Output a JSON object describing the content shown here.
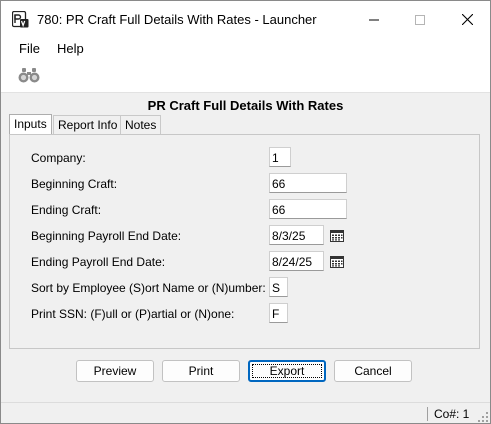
{
  "window": {
    "title": "780: PR Craft Full Details With Rates - Launcher",
    "app_icon": "report-launcher-icon"
  },
  "menu": {
    "file": "File",
    "help": "Help"
  },
  "toolbar": {
    "find_icon": "binoculars-icon"
  },
  "report": {
    "title": "PR Craft Full Details With Rates"
  },
  "tabs": [
    {
      "label": "Inputs",
      "active": true
    },
    {
      "label": "Report Info",
      "active": false
    },
    {
      "label": "Notes",
      "active": false
    }
  ],
  "fields": {
    "company": {
      "label": "Company:",
      "value": "1"
    },
    "beginning_craft": {
      "label": "Beginning Craft:",
      "value": "66"
    },
    "ending_craft": {
      "label": "Ending Craft:",
      "value": "66"
    },
    "beginning_payroll_end_date": {
      "label": "Beginning Payroll End Date:",
      "value": "8/3/25"
    },
    "ending_payroll_end_date": {
      "label": "Ending Payroll End Date:",
      "value": "8/24/25"
    },
    "sort_by": {
      "label": "Sort by Employee (S)ort Name or (N)umber:",
      "value": "S"
    },
    "print_ssn": {
      "label": "Print SSN: (F)ull or (P)artial or (N)one:",
      "value": "F"
    }
  },
  "buttons": {
    "preview": "Preview",
    "print": "Print",
    "export": "Export",
    "cancel": "Cancel"
  },
  "status": {
    "company": "Co#: 1"
  },
  "colors": {
    "accent": "#0067c0",
    "window_bg": "#f0f0f0",
    "titlebar_bg": "#ffffff"
  }
}
